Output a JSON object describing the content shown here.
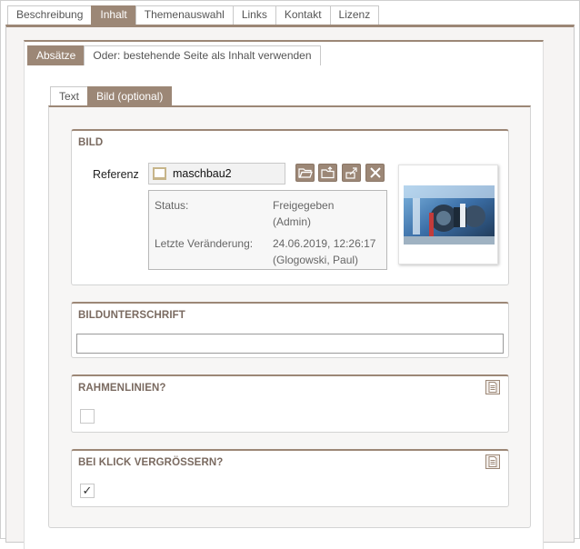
{
  "tabs_top": [
    {
      "label": "Beschreibung",
      "active": false
    },
    {
      "label": "Inhalt",
      "active": true
    },
    {
      "label": "Themenauswahl",
      "active": false
    },
    {
      "label": "Links",
      "active": false
    },
    {
      "label": "Kontakt",
      "active": false
    },
    {
      "label": "Lizenz",
      "active": false
    }
  ],
  "tabs_mid": [
    {
      "label": "Absätze",
      "active": true
    },
    {
      "label": "Oder: bestehende Seite als Inhalt verwenden",
      "active": false
    }
  ],
  "tabs_inner": [
    {
      "label": "Text",
      "active": false
    },
    {
      "label": "Bild (optional)",
      "active": true
    }
  ],
  "bild": {
    "title": "BILD",
    "ref_label": "Referenz",
    "ref_value": "maschbau2",
    "buttons": [
      "folder-open-icon",
      "folder-upload-icon",
      "edit-link-icon",
      "close-icon"
    ],
    "info": {
      "status_label": "Status:",
      "status_value_1": "Freigegeben",
      "status_value_2": "(Admin)",
      "changed_label": "Letzte Veränderung:",
      "changed_value_1": "24.06.2019, 12:26:17",
      "changed_value_2": "(Glogowski, Paul)"
    }
  },
  "caption": {
    "title": "BILDUNTERSCHRIFT",
    "value": ""
  },
  "frame_lines": {
    "title": "RAHMENLINIEN?",
    "checked": false
  },
  "click_enlarge": {
    "title": "BEI KLICK VERGRÖSSERN?",
    "checked": true,
    "check_glyph": "✓"
  },
  "colors": {
    "accent": "#9c8776",
    "title": "#7a6a60"
  }
}
